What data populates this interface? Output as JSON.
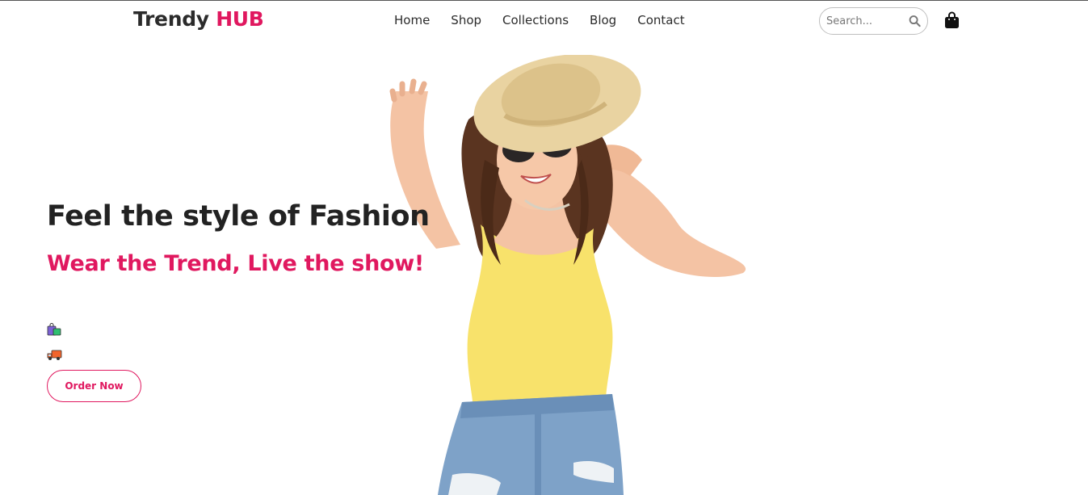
{
  "brand": {
    "name": "Trendy",
    "accent": "HUB",
    "accent_color": "#e0185f"
  },
  "nav": [
    {
      "label": "Home"
    },
    {
      "label": "Shop"
    },
    {
      "label": "Collections"
    },
    {
      "label": "Blog"
    },
    {
      "label": "Contact"
    }
  ],
  "search": {
    "placeholder": "Search...",
    "icon": "search-icon"
  },
  "cart": {
    "icon": "shopping-bag-icon"
  },
  "hero": {
    "title": "Feel the style of Fashion",
    "subtitle": "Wear the Trend, Live the show!",
    "features": [
      {
        "icon": "shopping-bags-emoji-icon"
      },
      {
        "icon": "delivery-truck-emoji-icon"
      }
    ],
    "cta": "Order Now",
    "image": "woman-in-sun-hat-photo"
  },
  "colors": {
    "text": "#222222",
    "accent": "#e0185f",
    "background": "#ffffff"
  }
}
